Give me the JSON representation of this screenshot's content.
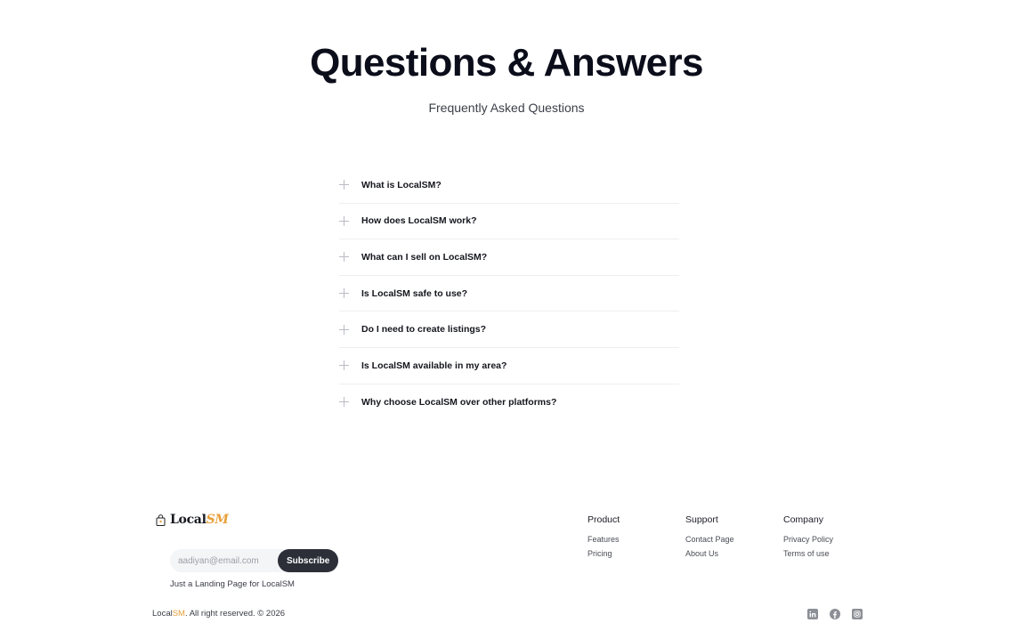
{
  "hero": {
    "title": "Questions & Answers",
    "subtitle": "Frequently Asked Questions"
  },
  "faq": {
    "items": [
      {
        "question": "What is LocalSM?"
      },
      {
        "question": "How does LocalSM work?"
      },
      {
        "question": "What can I sell on LocalSM?"
      },
      {
        "question": "Is LocalSM safe to use?"
      },
      {
        "question": "Do I need to create listings?"
      },
      {
        "question": "Is LocalSM available in my area?"
      },
      {
        "question": "Why choose LocalSM over other platforms?"
      }
    ],
    "expand_icon": "plus-icon"
  },
  "footer": {
    "logo": {
      "text_main": "Local",
      "text_accent": "SM",
      "icon": "shopping-bag-icon"
    },
    "newsletter": {
      "placeholder": "aadiyan@email.com",
      "button_label": "Subscribe"
    },
    "tagline": "Just a Landing Page for LocalSM",
    "columns": {
      "product": {
        "title": "Product",
        "links": [
          "Features",
          "Pricing"
        ]
      },
      "support": {
        "title": "Support",
        "links": [
          "Contact Page",
          "About Us"
        ]
      },
      "company": {
        "title": "Company",
        "links": [
          "Privacy Policy",
          "Terms of use"
        ]
      }
    },
    "copyright": {
      "brand_main": "Local",
      "brand_accent": "SM",
      "text": ". All right reserved. © 2026"
    },
    "socials": [
      "linkedin-icon",
      "facebook-icon",
      "instagram-icon"
    ]
  },
  "colors": {
    "accent": "#e8a03a",
    "button_dark": "#2c2f38",
    "text_dark": "#0b0e1a"
  }
}
